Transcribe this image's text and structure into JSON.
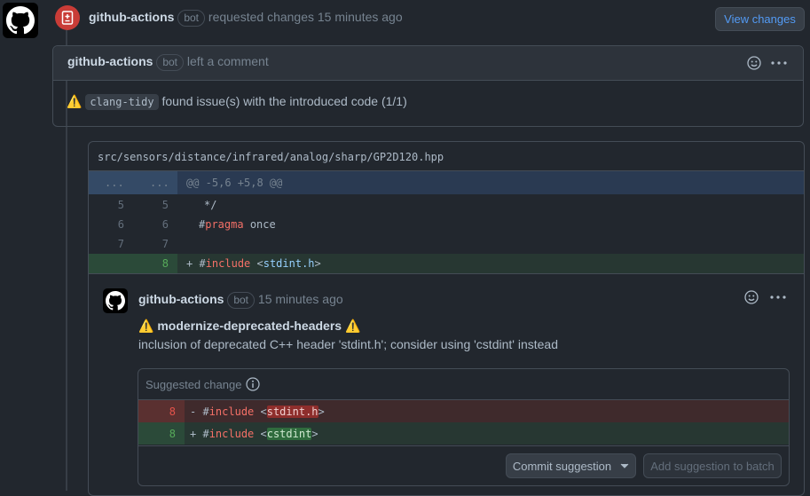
{
  "review": {
    "author": "github-actions",
    "badge": "bot",
    "action": "requested changes",
    "time": "15 minutes ago",
    "view_changes": "View changes"
  },
  "comment": {
    "author": "github-actions",
    "badge": "bot",
    "action": "left a comment",
    "tool": "clang-tidy",
    "message": "found issue(s) with the introduced code (1/1)"
  },
  "file": {
    "path": "src/sensors/distance/infrared/analog/sharp/GP2D120.hpp",
    "hunk_dots_left": "...",
    "hunk_dots_right": "...",
    "hunk": "@@ -5,6 +5,8 @@",
    "lines": [
      {
        "old": "5",
        "new": "5",
        "prefix": " ",
        "text": "*/"
      },
      {
        "old": "6",
        "new": "6",
        "prefix": " ",
        "hash": "#",
        "kw": "pragma",
        "rest": " once"
      },
      {
        "old": "7",
        "new": "7",
        "prefix": " ",
        "text": ""
      },
      {
        "old": "",
        "new": "8",
        "prefix": "+",
        "hash": "#",
        "kw": "include",
        "open": " <",
        "hdr": "stdint.h",
        "close": ">"
      }
    ]
  },
  "inline": {
    "author": "github-actions",
    "badge": "bot",
    "time": "15 minutes ago",
    "title": "modernize-deprecated-headers",
    "body": "inclusion of deprecated C++ header 'stdint.h'; consider using 'cstdint' instead",
    "suggested_label": "Suggested change",
    "removed": {
      "ln": "8",
      "prefix": "-",
      "hash": "#",
      "kw": "include",
      "open": " <",
      "hdr": "stdint.h",
      "close": ">"
    },
    "added": {
      "ln": "8",
      "prefix": "+",
      "hash": "#",
      "kw": "include",
      "open": " <",
      "hdr": "cstdint",
      "close": ">"
    },
    "commit_button": "Commit suggestion",
    "batch_button": "Add suggestion to batch"
  },
  "colors": {
    "bg": "#22272e",
    "review_icon": "#e5534b",
    "added_bg": "#273732",
    "removed_bg": "#3f2a2c",
    "hunk_bg": "#2a3a52"
  }
}
